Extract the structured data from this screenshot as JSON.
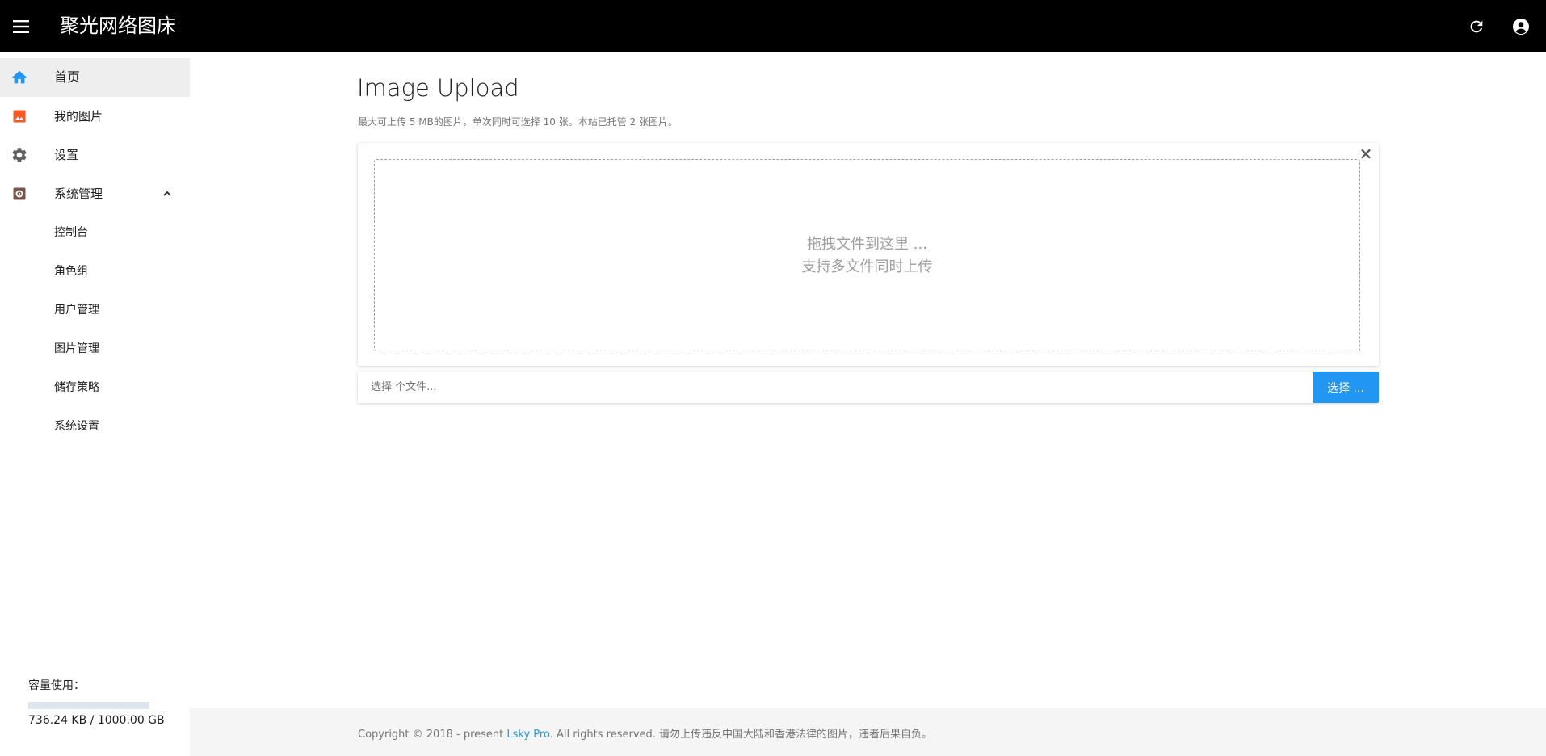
{
  "header": {
    "title": "聚光网络图床",
    "menu_icon": "menu-icon",
    "refresh_icon": "refresh-icon",
    "account_icon": "account-circle-icon"
  },
  "sidebar": {
    "items": [
      {
        "label": "首页",
        "icon": "home-icon",
        "icon_color": "#2196f3",
        "active": true
      },
      {
        "label": "我的图片",
        "icon": "image-icon",
        "icon_color": "#ff5722"
      },
      {
        "label": "设置",
        "icon": "gear-icon",
        "icon_color": "#616161"
      },
      {
        "label": "系统管理",
        "icon": "admin-settings-icon",
        "icon_color": "#795548",
        "expanded": true
      }
    ],
    "sub_items": [
      {
        "label": "控制台"
      },
      {
        "label": "角色组"
      },
      {
        "label": "用户管理"
      },
      {
        "label": "图片管理"
      },
      {
        "label": "储存策略"
      },
      {
        "label": "系统设置"
      }
    ],
    "quota": {
      "label": "容量使用：",
      "text": "736.24 KB / 1000.00 GB",
      "fraction": 7e-07
    }
  },
  "main": {
    "title": "Image Upload",
    "subtitle": "最大可上传 5 MB的图片，单次同时可选择 10 张。本站已托管 2 张图片。",
    "close_symbol": "×",
    "dropzone": {
      "line1": "拖拽文件到这里 ...",
      "line2": "支持多文件同时上传"
    },
    "file_input_placeholder": "选择 个文件...",
    "choose_button": "选择 ..."
  },
  "footer": {
    "prefix": "Copyright © 2018 - present ",
    "link": "Lsky Pro",
    "suffix": ". All rights reserved. 请勿上传违反中国大陆和香港法律的图片，违者后果自负。"
  },
  "colors": {
    "accent": "#2196f3",
    "header_bg": "#000000",
    "footer_bg": "#f5f5f5"
  }
}
